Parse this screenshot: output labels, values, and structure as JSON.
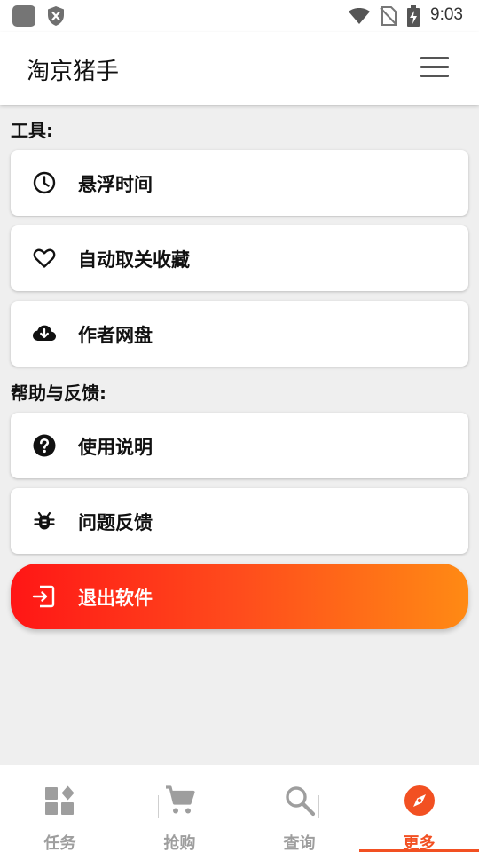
{
  "status_bar": {
    "time": "9:03",
    "icons": [
      "app-icon",
      "shield-icon",
      "wifi-icon",
      "no-sim-icon",
      "battery-charging-icon"
    ]
  },
  "app_bar": {
    "title": "淘京猪手",
    "menu_icon": "hamburger-menu-icon"
  },
  "sections": [
    {
      "title": "工具:",
      "items": [
        {
          "label": "悬浮时间",
          "icon": "clock-icon"
        },
        {
          "label": "自动取关收藏",
          "icon": "heart-icon"
        },
        {
          "label": "作者网盘",
          "icon": "cloud-download-icon"
        }
      ]
    },
    {
      "title": "帮助与反馈:",
      "items": [
        {
          "label": "使用说明",
          "icon": "help-circle-icon"
        },
        {
          "label": "问题反馈",
          "icon": "bug-icon"
        }
      ]
    }
  ],
  "exit_button": {
    "label": "退出软件",
    "icon": "exit-icon",
    "gradient": [
      "#ff1616",
      "#ff8a14"
    ]
  },
  "bottom_nav": {
    "items": [
      {
        "label": "任务",
        "icon": "dashboard-icon",
        "active": false
      },
      {
        "label": "抢购",
        "icon": "cart-icon",
        "active": false
      },
      {
        "label": "查询",
        "icon": "search-icon",
        "active": false
      },
      {
        "label": "更多",
        "icon": "compass-icon",
        "active": true
      }
    ],
    "active_color": "#f25022",
    "inactive_color": "#9e9e9e"
  }
}
